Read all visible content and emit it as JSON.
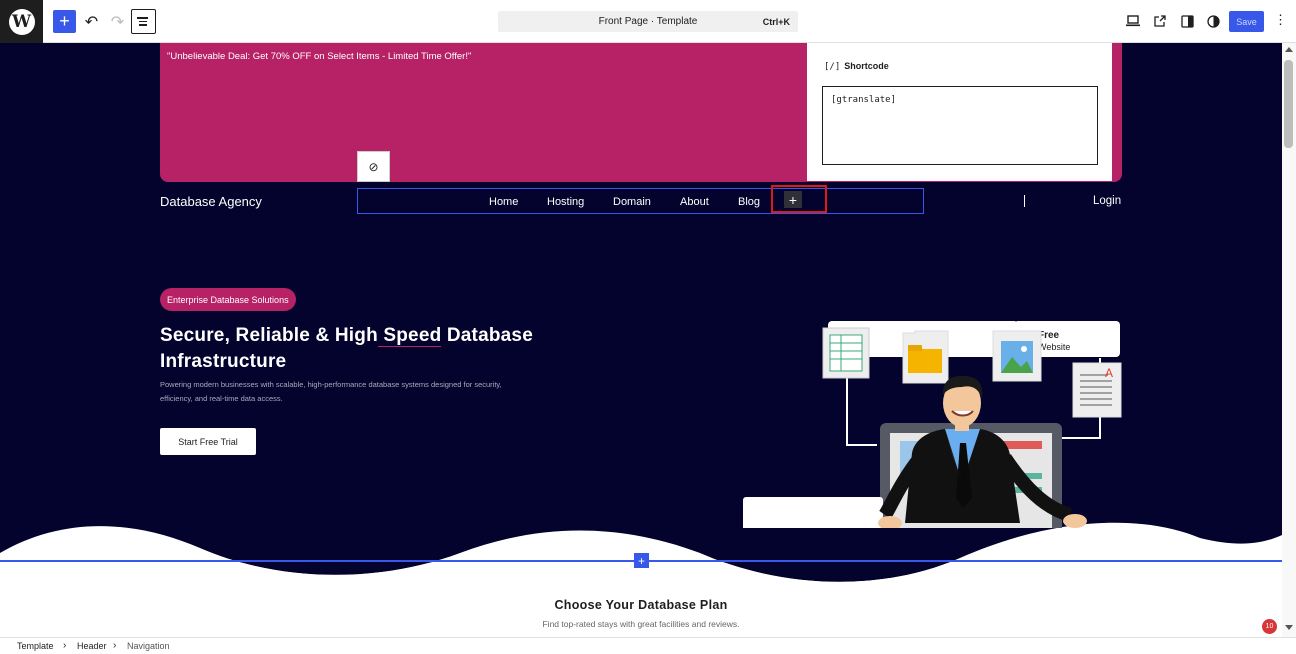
{
  "toolbar": {
    "command_title": "Front Page · Template",
    "command_shortcut": "Ctrl+K",
    "save_label": "Save"
  },
  "promo": {
    "text": "\"Unbelievable Deal: Get 70% OFF on Select Items - Limited Time Offer!\""
  },
  "shortcode": {
    "label": "Shortcode",
    "icon_text": "[/]",
    "value": "[gtranslate]"
  },
  "header": {
    "brand": "Database Agency",
    "nav": [
      "Home",
      "Hosting",
      "Domain",
      "About",
      "Blog"
    ],
    "login": "Login"
  },
  "hero": {
    "badge": "Enterprise Database Solutions",
    "headline_part1": "Secure, Reliable & High",
    "headline_highlight": " Speed",
    "headline_part2": " Database",
    "headline_line2": " Infrastructure",
    "paragraph": "Powering modern businesses with scalable, high-performance database systems designed for security, efficiency, and real-time data access.",
    "cta": "Start Free Trial",
    "illustration_card_line1": "Free",
    "illustration_card_line2": "Website"
  },
  "plans": {
    "title": "Choose Your Database Plan",
    "subtitle": "Find top-rated stays with great facilities and reviews."
  },
  "notification_count": "10",
  "breadcrumbs": [
    "Template",
    "Header",
    "Navigation"
  ],
  "colors": {
    "accent": "#3858e9",
    "brand_pink": "#b72266",
    "hero_bg": "#03032d",
    "highlight_red": "#e01818"
  }
}
